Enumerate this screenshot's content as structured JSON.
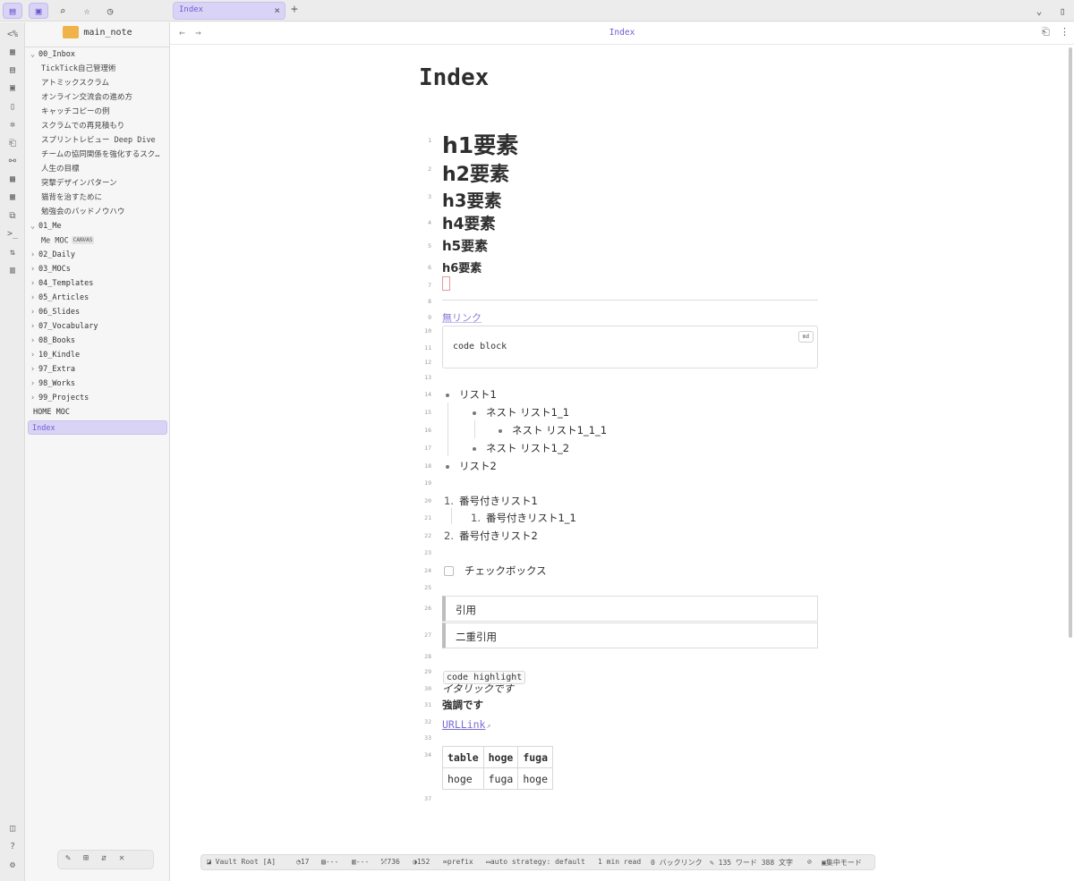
{
  "topbar": {
    "tab_label": "Index",
    "tab_close": "×",
    "new_tab": "+",
    "right_chevron": "⌄",
    "right_sidebar": "▯"
  },
  "sidebar": {
    "vault_name": "main_note",
    "tree": [
      {
        "label": "00_Inbox",
        "type": "folder-open"
      },
      {
        "label": "TickTick自己管理術",
        "type": "file"
      },
      {
        "label": "アトミックスクラム",
        "type": "file"
      },
      {
        "label": "オンライン交流会の進め方",
        "type": "file"
      },
      {
        "label": "キャッチコピーの例",
        "type": "file"
      },
      {
        "label": "スクラムでの再見積もり",
        "type": "file"
      },
      {
        "label": "スプリントレビュー Deep Dive",
        "type": "file"
      },
      {
        "label": "チームの協同関係を強化するスク…",
        "type": "file"
      },
      {
        "label": "人生の目標",
        "type": "file"
      },
      {
        "label": "突撃デザインパターン",
        "type": "file"
      },
      {
        "label": "猫背を治すために",
        "type": "file"
      },
      {
        "label": "勉強会のバッドノウハウ",
        "type": "file"
      },
      {
        "label": "01_Me",
        "type": "folder-open"
      },
      {
        "label": "Me MOC",
        "type": "file",
        "badge": "CANVAS"
      },
      {
        "label": "02_Daily",
        "type": "folder"
      },
      {
        "label": "03_MOCs",
        "type": "folder"
      },
      {
        "label": "04_Templates",
        "type": "folder"
      },
      {
        "label": "05_Articles",
        "type": "folder"
      },
      {
        "label": "06_Slides",
        "type": "folder"
      },
      {
        "label": "07_Vocabulary",
        "type": "folder"
      },
      {
        "label": "08_Books",
        "type": "folder"
      },
      {
        "label": "10_Kindle",
        "type": "folder"
      },
      {
        "label": "97_Extra",
        "type": "folder"
      },
      {
        "label": "98_Works",
        "type": "folder"
      },
      {
        "label": "99_Projects",
        "type": "folder"
      },
      {
        "label": "HOME MOC",
        "type": "root-file"
      },
      {
        "label": "Index",
        "type": "selected"
      }
    ]
  },
  "main": {
    "header_title": "Index",
    "doc_title": "Index",
    "h1": "h1要素",
    "h2": "h2要素",
    "h3": "h3要素",
    "h4": "h4要素",
    "h5": "h5要素",
    "h6": "h6要素",
    "dead_link": "無リンク",
    "code_block": "code block",
    "code_lang": "md",
    "list1": "リスト1",
    "list1_1": "ネスト リスト1_1",
    "list1_1_1": "ネスト リスト1_1_1",
    "list1_2": "ネスト リスト1_2",
    "list2": "リスト2",
    "ol1_num": "1.",
    "ol1": "番号付きリスト1",
    "ol1_1_num": "1.",
    "ol1_1": "番号付きリスト1_1",
    "ol2_num": "2.",
    "ol2": "番号付きリスト2",
    "checkbox": "チェックボックス",
    "quote": "引用",
    "quote2": "二重引用",
    "code_highlight": "code highlight",
    "italic": "イタリックです",
    "bold": "強調です",
    "url_link": "URLLink",
    "table": [
      [
        "table",
        "hoge",
        "fuga"
      ],
      [
        "hoge",
        "fuga",
        "hoge"
      ]
    ],
    "line_numbers": [
      "1",
      "2",
      "3",
      "4",
      "5",
      "6",
      "7",
      "8",
      "9",
      "10",
      "11",
      "12",
      "13",
      "14",
      "15",
      "16",
      "17",
      "18",
      "19",
      "20",
      "21",
      "22",
      "23",
      "24",
      "25",
      "26",
      "27",
      "28",
      "29",
      "30",
      "31",
      "32",
      "33",
      "34",
      "37"
    ]
  },
  "statusbar": {
    "vault_root": "Vault Root [A]",
    "count1": "17",
    "count2": "---",
    "count3": "---",
    "count4": "736",
    "count5": "152",
    "prefix": "prefix",
    "strategy": "auto strategy: default",
    "read": "1 min read",
    "backlinks": "0 バックリンク",
    "words": "135 ワード 388 文字",
    "focus": "集中モード"
  }
}
